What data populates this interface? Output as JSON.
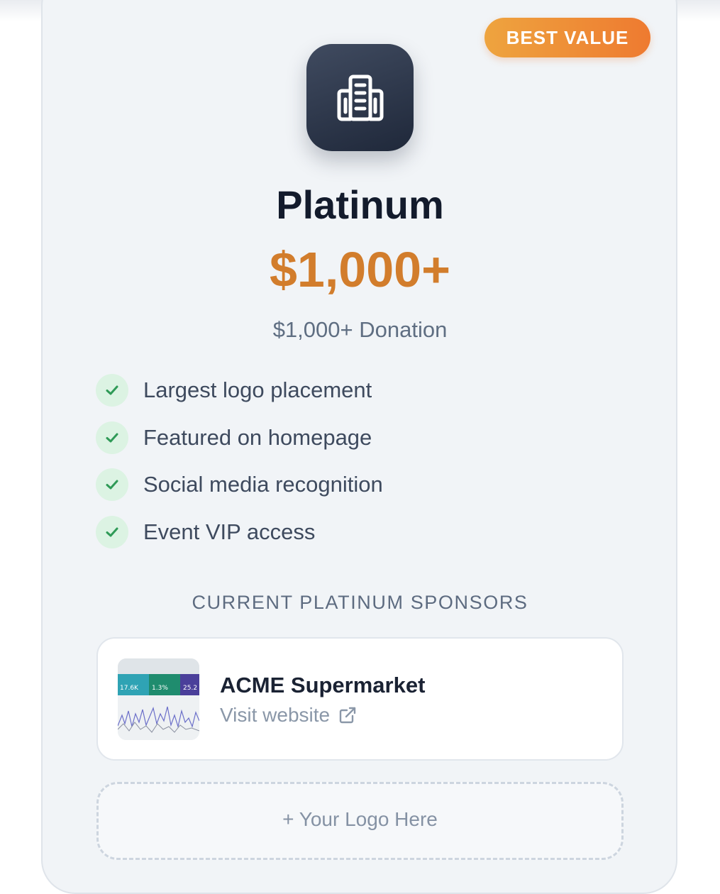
{
  "tier": {
    "badge": "BEST VALUE",
    "icon": "building-icon",
    "name": "Platinum",
    "price": "$1,000+",
    "subtitle": "$1,000+ Donation",
    "accent_color": "#d27d2c",
    "badge_gradient": [
      "#eea43f",
      "#ee7a30"
    ]
  },
  "benefits": [
    {
      "label": "Largest logo placement",
      "icon": "check-icon"
    },
    {
      "label": "Featured on homepage",
      "icon": "check-icon"
    },
    {
      "label": "Social media recognition",
      "icon": "check-icon"
    },
    {
      "label": "Event VIP access",
      "icon": "check-icon"
    }
  ],
  "sponsors_section": {
    "heading": "CURRENT PLATINUM SPONSORS",
    "sponsors": [
      {
        "name": "ACME Supermarket",
        "link_label": "Visit website",
        "link_icon": "external-link-icon",
        "thumbnail_stats": [
          "17.6K",
          "1.3%",
          "25.2"
        ]
      }
    ],
    "placeholder": "+ Your Logo Here"
  }
}
